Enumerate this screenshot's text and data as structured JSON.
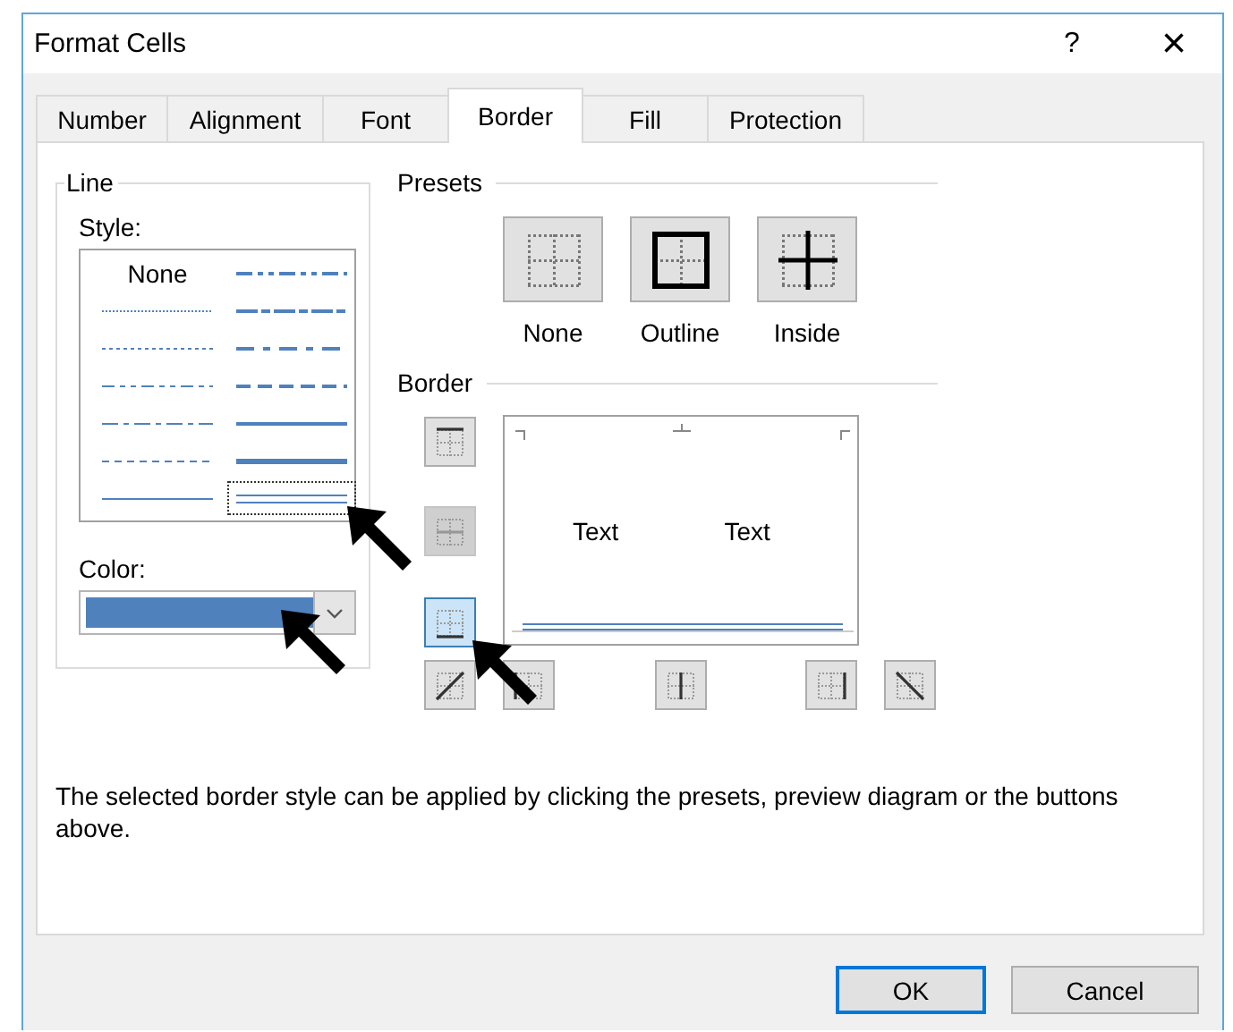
{
  "window": {
    "title": "Format Cells",
    "help": "?",
    "close": "×"
  },
  "tabs": [
    {
      "label": "Number",
      "selected": false
    },
    {
      "label": "Alignment",
      "selected": false
    },
    {
      "label": "Font",
      "selected": false
    },
    {
      "label": "Border",
      "selected": true
    },
    {
      "label": "Fill",
      "selected": false
    },
    {
      "label": "Protection",
      "selected": false
    }
  ],
  "line": {
    "title": "Line",
    "style_label": "Style:",
    "color_label": "Color:",
    "color": "#4f81bd",
    "styles": [
      {
        "kind": "none",
        "label": "None",
        "selected": false
      },
      {
        "kind": "medium_dash_dot_dot",
        "selected": false
      },
      {
        "kind": "hair",
        "selected": false
      },
      {
        "kind": "slant_dash_dot",
        "selected": false
      },
      {
        "kind": "dotted",
        "selected": false
      },
      {
        "kind": "medium_dash_dot",
        "selected": false
      },
      {
        "kind": "dash_dot_dot",
        "selected": false
      },
      {
        "kind": "medium_dashed",
        "selected": false
      },
      {
        "kind": "dash_dot",
        "selected": false
      },
      {
        "kind": "medium",
        "selected": false
      },
      {
        "kind": "dashed",
        "selected": false
      },
      {
        "kind": "thick",
        "selected": false
      },
      {
        "kind": "thin",
        "selected": false
      },
      {
        "kind": "double",
        "selected": true
      }
    ]
  },
  "presets": {
    "title": "Presets",
    "items": [
      {
        "kind": "none",
        "label": "None"
      },
      {
        "kind": "outline",
        "label": "Outline"
      },
      {
        "kind": "inside",
        "label": "Inside"
      }
    ]
  },
  "border": {
    "title": "Border",
    "side_buttons": [
      {
        "kind": "top",
        "on": false,
        "disabled": false
      },
      {
        "kind": "middle_h",
        "on": false,
        "disabled": true
      },
      {
        "kind": "bottom",
        "on": true,
        "disabled": false
      }
    ],
    "bottom_buttons": [
      {
        "kind": "diag_up",
        "on": false,
        "disabled": false
      },
      {
        "kind": "left",
        "on": false,
        "disabled": false
      },
      {
        "kind": "center_v",
        "on": false,
        "disabled": false
      },
      {
        "kind": "right",
        "on": false,
        "disabled": false
      },
      {
        "kind": "diag_down",
        "on": false,
        "disabled": false
      }
    ],
    "preview_texts": [
      "Text",
      "Text"
    ]
  },
  "help_text": "The selected border style can be applied by clicking the presets, preview diagram or the buttons above.",
  "buttons": [
    {
      "label": "OK",
      "default": true
    },
    {
      "label": "Cancel",
      "default": false
    }
  ]
}
